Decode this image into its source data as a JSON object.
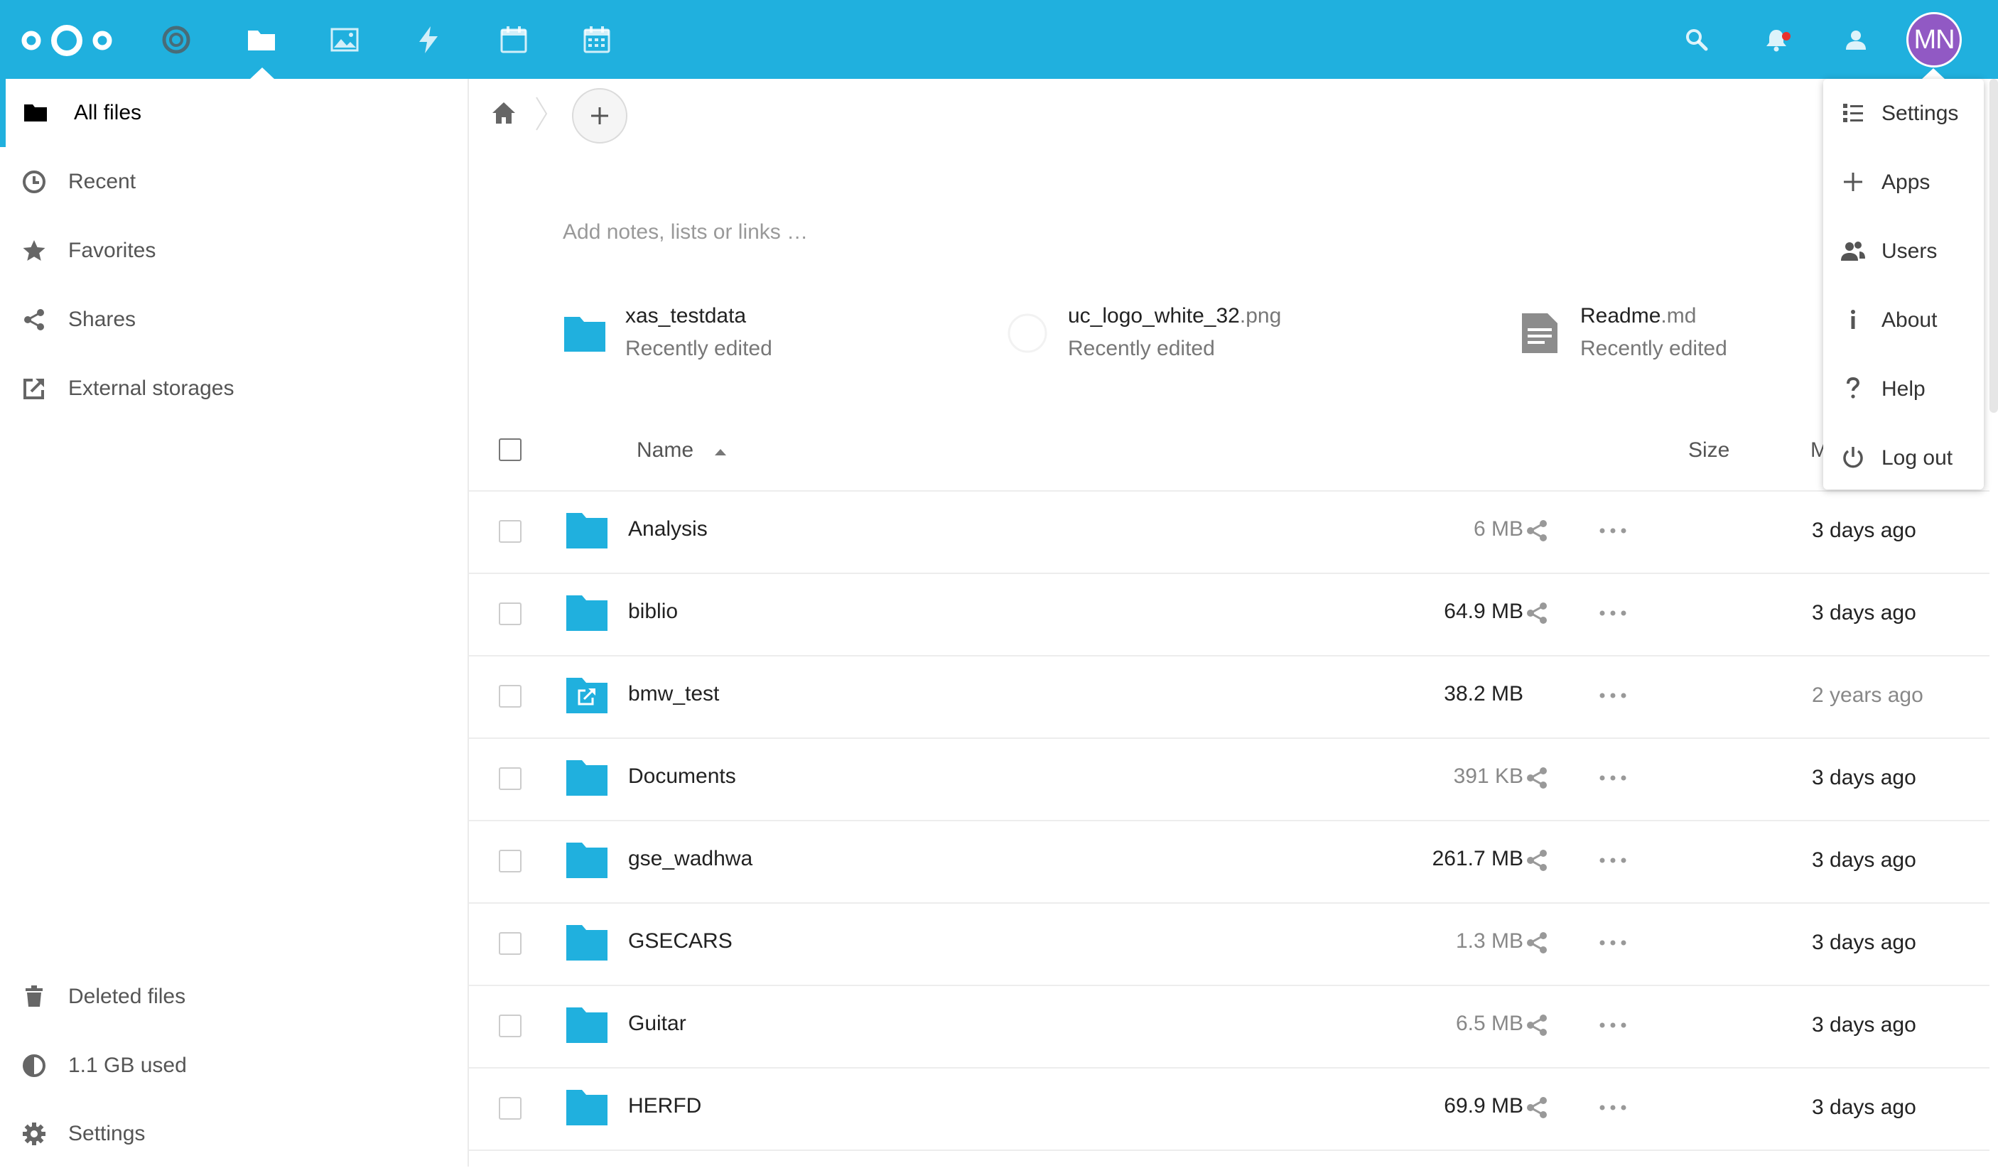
{
  "header": {
    "avatar_initials": "MN",
    "colors": {
      "bar": "#20b0de",
      "avatar": "#9159c4"
    },
    "apps": [
      {
        "name": "dashboard-icon"
      },
      {
        "name": "files-icon",
        "active": true
      },
      {
        "name": "photos-icon"
      },
      {
        "name": "activity-icon"
      },
      {
        "name": "calendar-icon"
      },
      {
        "name": "calendar-grid-icon"
      }
    ],
    "right_icons": [
      "search-icon",
      "notifications-icon",
      "contacts-icon"
    ]
  },
  "sidebar": {
    "items": [
      {
        "label": "All files",
        "icon": "folder-icon",
        "active": true
      },
      {
        "label": "Recent",
        "icon": "clock-icon"
      },
      {
        "label": "Favorites",
        "icon": "star-icon"
      },
      {
        "label": "Shares",
        "icon": "share-icon"
      },
      {
        "label": "External storages",
        "icon": "external-link-icon"
      }
    ],
    "bottom": [
      {
        "label": "Deleted files",
        "icon": "trash-icon"
      },
      {
        "label": "1.1 GB used",
        "icon": "quota-pie-icon"
      },
      {
        "label": "Settings",
        "icon": "gear-icon"
      }
    ]
  },
  "content": {
    "notes_placeholder": "Add notes, lists or links …",
    "recent": [
      {
        "name": "xas_testdata",
        "ext": "",
        "sub": "Recently edited",
        "icon": "folder-icon"
      },
      {
        "name": "uc_logo_white_32",
        "ext": ".png",
        "sub": "Recently edited",
        "icon": "image-placeholder-icon"
      },
      {
        "name": "Readme",
        "ext": ".md",
        "sub": "Recently edited",
        "icon": "document-icon"
      }
    ],
    "columns": {
      "name": "Name",
      "size": "Size",
      "modified": "M"
    },
    "rows": [
      {
        "name": "Analysis",
        "size": "6 MB",
        "modified": "3 days ago",
        "shared": true,
        "external": false
      },
      {
        "name": "biblio",
        "size": "64.9 MB",
        "modified": "3 days ago",
        "shared": true,
        "external": false
      },
      {
        "name": "bmw_test",
        "size": "38.2 MB",
        "modified": "2 years ago",
        "shared": false,
        "external": true
      },
      {
        "name": "Documents",
        "size": "391 KB",
        "modified": "3 days ago",
        "shared": true,
        "external": false
      },
      {
        "name": "gse_wadhwa",
        "size": "261.7 MB",
        "modified": "3 days ago",
        "shared": true,
        "external": false
      },
      {
        "name": "GSECARS",
        "size": "1.3 MB",
        "modified": "3 days ago",
        "shared": true,
        "external": false
      },
      {
        "name": "Guitar",
        "size": "6.5 MB",
        "modified": "3 days ago",
        "shared": true,
        "external": false
      },
      {
        "name": "HERFD",
        "size": "69.9 MB",
        "modified": "3 days ago",
        "shared": true,
        "external": false
      }
    ]
  },
  "user_menu": {
    "items": [
      {
        "label": "Settings",
        "icon": "settings-list-icon"
      },
      {
        "label": "Apps",
        "icon": "plus-icon"
      },
      {
        "label": "Users",
        "icon": "users-icon"
      },
      {
        "label": "About",
        "icon": "info-icon"
      },
      {
        "label": "Help",
        "icon": "help-icon"
      },
      {
        "label": "Log out",
        "icon": "power-icon"
      }
    ]
  }
}
